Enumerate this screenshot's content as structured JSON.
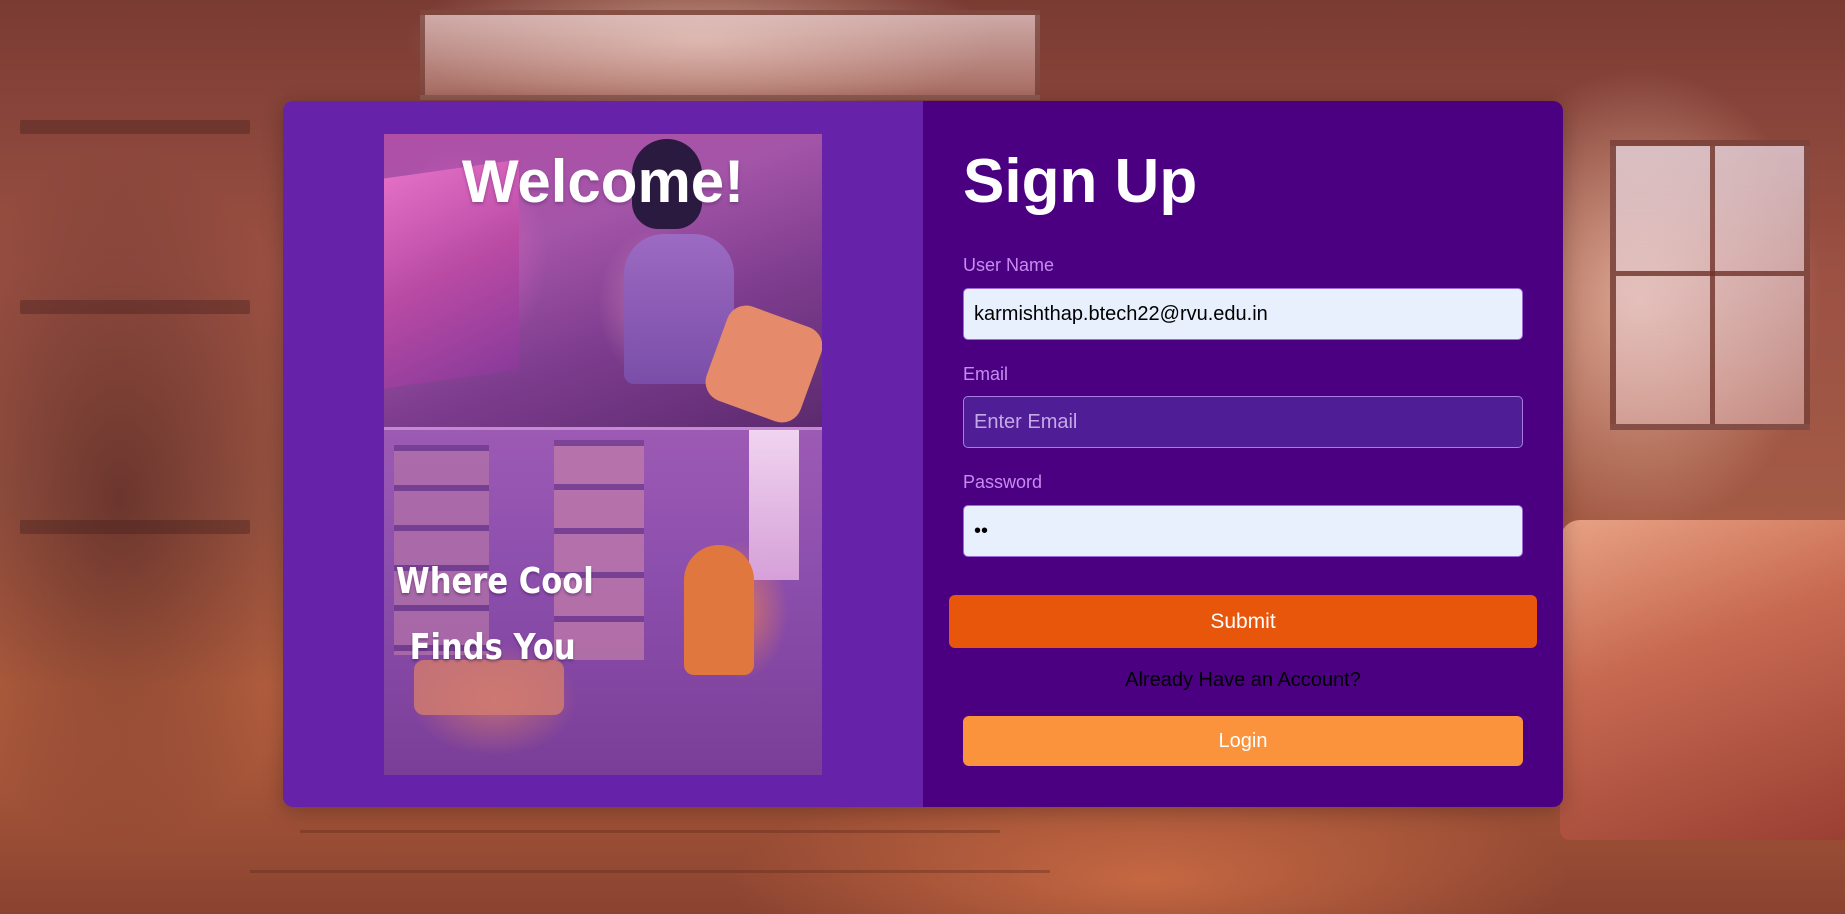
{
  "background": {
    "description_icon": "cozy-room-background"
  },
  "hero": {
    "title": "Welcome!",
    "tagline_line1": "Where Cool",
    "tagline_line2": "Finds You"
  },
  "form": {
    "title": "Sign Up",
    "username": {
      "label": "User Name",
      "value": "karmishthap.btech22@rvu.edu.in"
    },
    "email": {
      "label": "Email",
      "value": "",
      "placeholder": "Enter Email"
    },
    "password": {
      "label": "Password",
      "value": "••"
    },
    "submit_label": "Submit",
    "account_prompt": "Already Have an Account?",
    "login_label": "Login"
  },
  "colors": {
    "left_panel": "#6622a8",
    "right_panel": "#4b0082",
    "submit": "#e8560c",
    "login": "#fb923c",
    "label": "#c78bf0"
  }
}
